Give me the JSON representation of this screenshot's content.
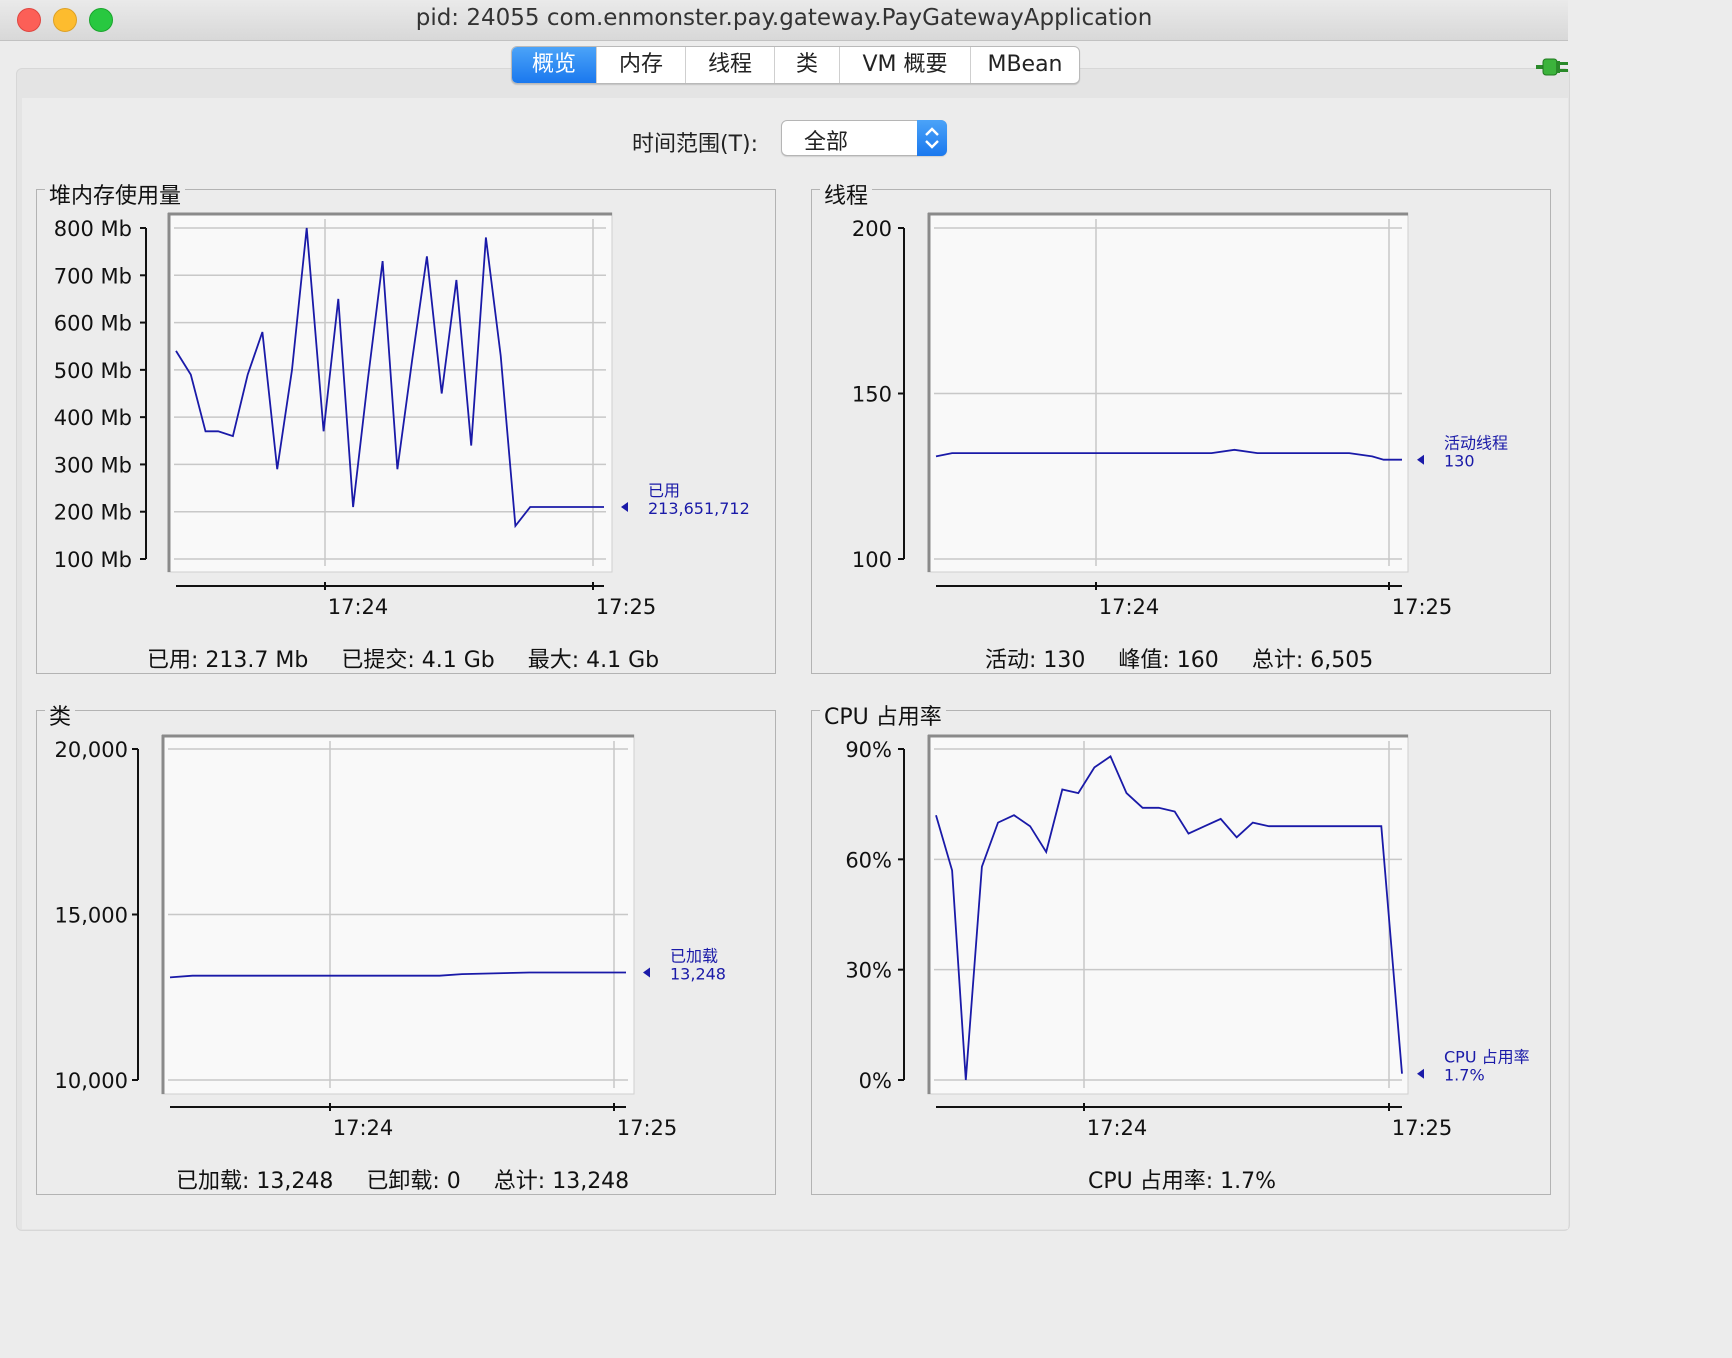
{
  "window": {
    "title": "pid: 24055 com.enmonster.pay.gateway.PayGatewayApplication"
  },
  "tabs": [
    {
      "label": "概览",
      "active": true
    },
    {
      "label": "内存",
      "active": false
    },
    {
      "label": "线程",
      "active": false
    },
    {
      "label": "类",
      "active": false
    },
    {
      "label": "VM 概要",
      "active": false
    },
    {
      "label": "MBean",
      "active": false
    }
  ],
  "time_range": {
    "label": "时间范围(T):",
    "value": "全部"
  },
  "colors": {
    "line": "#1a1aa8",
    "accent": "#1a78ee"
  },
  "panels": {
    "heap": {
      "title": "堆内存使用量",
      "series_label": "已用",
      "series_value": "213,651,712",
      "summary": {
        "used": "已用: 213.7 Mb",
        "committed": "已提交: 4.1 Gb",
        "max": "最大: 4.1 Gb"
      }
    },
    "threads": {
      "title": "线程",
      "series_label": "活动线程",
      "series_value": "130",
      "summary": {
        "live": "活动: 130",
        "peak": "峰值: 160",
        "total": "总计: 6,505"
      }
    },
    "classes": {
      "title": "类",
      "series_label": "已加载",
      "series_value": "13,248",
      "summary": {
        "loaded": "已加载: 13,248",
        "unloaded": "已卸载: 0",
        "total": "总计: 13,248"
      }
    },
    "cpu": {
      "title": "CPU 占用率",
      "series_label": "CPU 占用率",
      "series_value": "1.7%",
      "summary": {
        "usage": "CPU 占用率: 1.7%"
      }
    }
  },
  "chart_data": [
    {
      "type": "line",
      "title": "堆内存使用量",
      "y_unit": "Mb",
      "yticks": [
        "100 Mb",
        "200 Mb",
        "300 Mb",
        "400 Mb",
        "500 Mb",
        "600 Mb",
        "700 Mb",
        "800 Mb"
      ],
      "ylim": [
        100,
        800
      ],
      "xticks": [
        "17:24",
        "17:25"
      ],
      "x_tick_positions_min": [
        1,
        2
      ],
      "xlim": [
        0,
        2.03
      ],
      "series": [
        {
          "name": "已用",
          "x": [
            0.0,
            0.07,
            0.14,
            0.2,
            0.27,
            0.34,
            0.41,
            0.48,
            0.55,
            0.62,
            0.7,
            0.77,
            0.84,
            0.91,
            0.98,
            1.05,
            1.12,
            1.19,
            1.26,
            1.33,
            1.4,
            1.47,
            1.54,
            1.61,
            1.68,
            1.75,
            1.82,
            1.89,
            1.96,
            2.03
          ],
          "values": [
            540,
            490,
            370,
            370,
            360,
            490,
            580,
            290,
            500,
            800,
            370,
            650,
            210,
            480,
            730,
            290,
            520,
            740,
            450,
            690,
            340,
            780,
            530,
            170,
            210,
            210,
            210,
            210,
            210,
            210
          ]
        }
      ]
    },
    {
      "type": "line",
      "title": "线程",
      "yticks": [
        "100",
        "150",
        "200"
      ],
      "ylim": [
        100,
        200
      ],
      "xticks": [
        "17:24",
        "17:25"
      ],
      "x_tick_positions_min": [
        1,
        2
      ],
      "xlim": [
        0,
        2.03
      ],
      "series": [
        {
          "name": "活动线程",
          "x": [
            0,
            0.07,
            0.2,
            0.5,
            0.8,
            1.0,
            1.2,
            1.3,
            1.4,
            1.6,
            1.8,
            1.9,
            1.95,
            2.03
          ],
          "values": [
            131,
            132,
            132,
            132,
            132,
            132,
            132,
            133,
            132,
            132,
            132,
            131,
            130,
            130
          ]
        }
      ]
    },
    {
      "type": "line",
      "title": "类",
      "yticks": [
        "10,000",
        "15,000",
        "20,000"
      ],
      "ylim": [
        10000,
        20000
      ],
      "xticks": [
        "17:24",
        "17:25"
      ],
      "x_tick_positions_min": [
        1,
        2
      ],
      "xlim": [
        0,
        2.03
      ],
      "series": [
        {
          "name": "已加载",
          "x": [
            0,
            0.1,
            0.5,
            1.0,
            1.2,
            1.3,
            1.6,
            2.0,
            2.03
          ],
          "values": [
            13100,
            13150,
            13150,
            13150,
            13150,
            13200,
            13248,
            13248,
            13248
          ]
        }
      ]
    },
    {
      "type": "line",
      "title": "CPU 占用率",
      "yticks": [
        "0%",
        "30%",
        "60%",
        "90%"
      ],
      "ylim": [
        0,
        90
      ],
      "xticks": [
        "17:24",
        "17:25"
      ],
      "x_tick_positions_min": [
        1,
        2
      ],
      "xlim": [
        0,
        2.03
      ],
      "series": [
        {
          "name": "CPU 占用率",
          "x": [
            0.0,
            0.07,
            0.13,
            0.2,
            0.27,
            0.34,
            0.41,
            0.48,
            0.55,
            0.62,
            0.69,
            0.76,
            0.83,
            0.9,
            0.97,
            1.04,
            1.1,
            1.17,
            1.24,
            1.31,
            1.38,
            1.45,
            1.52,
            1.59,
            1.66,
            1.73,
            1.8,
            1.87,
            1.94,
            2.03
          ],
          "values": [
            72,
            57,
            0,
            58,
            70,
            72,
            69,
            62,
            79,
            78,
            85,
            88,
            78,
            74,
            74,
            73,
            67,
            69,
            71,
            66,
            70,
            69,
            69,
            69,
            69,
            69,
            69,
            69,
            69,
            1.7
          ]
        }
      ]
    }
  ]
}
